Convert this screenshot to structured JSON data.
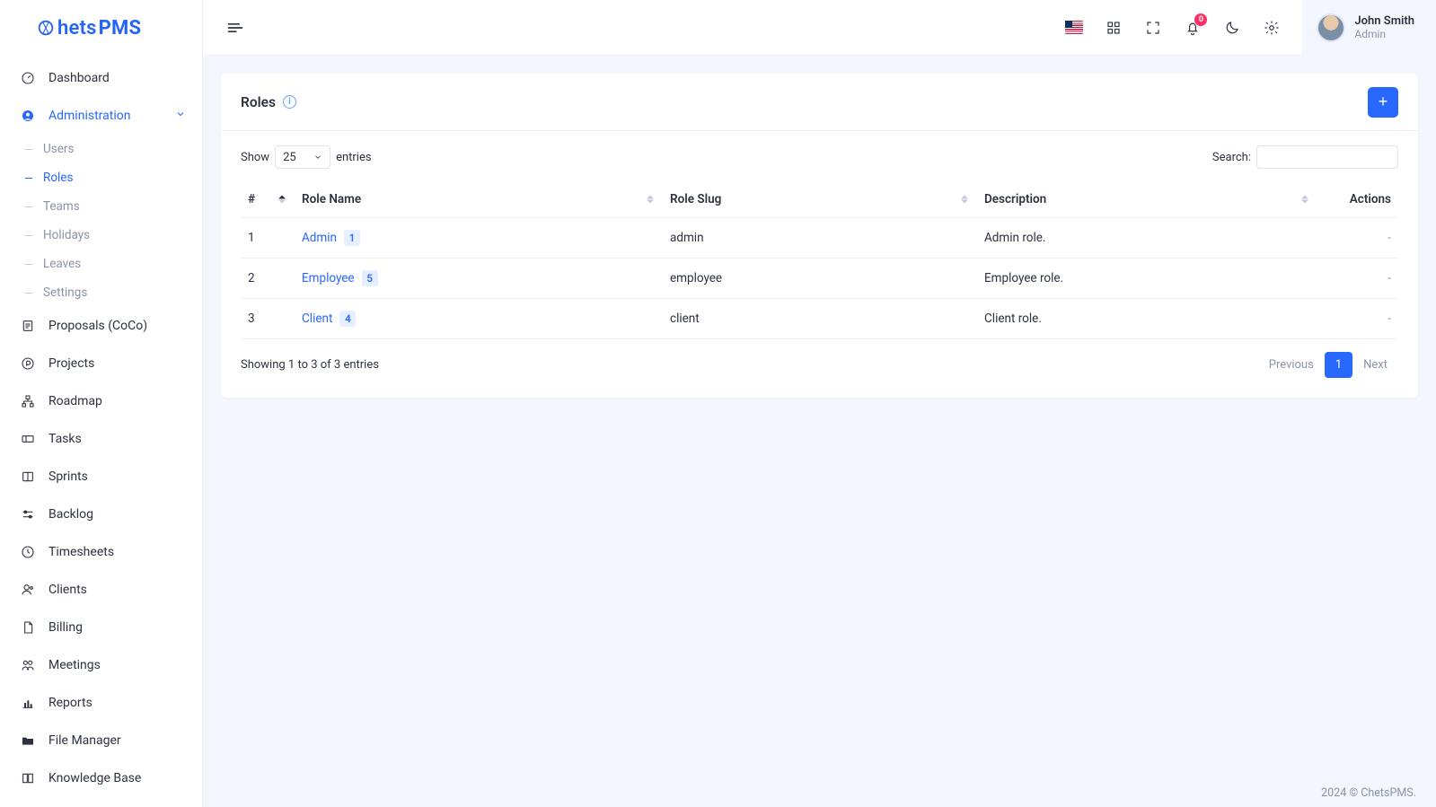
{
  "brand": {
    "name_a": "hets",
    "name_b": "PMS"
  },
  "header": {
    "notif_count": "0",
    "user": {
      "name": "John Smith",
      "role": "Admin"
    }
  },
  "sidebar": {
    "items": [
      {
        "label": "Dashboard"
      },
      {
        "label": "Administration",
        "active": true,
        "expanded": true
      },
      {
        "label": "Proposals (CoCo)"
      },
      {
        "label": "Projects"
      },
      {
        "label": "Roadmap"
      },
      {
        "label": "Tasks"
      },
      {
        "label": "Sprints"
      },
      {
        "label": "Backlog"
      },
      {
        "label": "Timesheets"
      },
      {
        "label": "Clients"
      },
      {
        "label": "Billing"
      },
      {
        "label": "Meetings"
      },
      {
        "label": "Reports"
      },
      {
        "label": "File Manager"
      },
      {
        "label": "Knowledge Base"
      }
    ],
    "admin_sub": [
      {
        "label": "Users"
      },
      {
        "label": "Roles",
        "active": true
      },
      {
        "label": "Teams"
      },
      {
        "label": "Holidays"
      },
      {
        "label": "Leaves"
      },
      {
        "label": "Settings"
      }
    ]
  },
  "page": {
    "title": "Roles",
    "add_label": "+",
    "show_label": "Show",
    "entries_label": "entries",
    "show_value": "25",
    "search_label": "Search:",
    "columns": {
      "idx": "#",
      "name": "Role Name",
      "slug": "Role Slug",
      "desc": "Description",
      "actions": "Actions"
    },
    "rows": [
      {
        "idx": "1",
        "name": "Admin",
        "count": "1",
        "slug": "admin",
        "desc": "Admin role.",
        "actions": "-"
      },
      {
        "idx": "2",
        "name": "Employee",
        "count": "5",
        "slug": "employee",
        "desc": "Employee role.",
        "actions": "-"
      },
      {
        "idx": "3",
        "name": "Client",
        "count": "4",
        "slug": "client",
        "desc": "Client role.",
        "actions": "-"
      }
    ],
    "info": "Showing 1 to 3 of 3 entries",
    "pager": {
      "prev": "Previous",
      "page": "1",
      "next": "Next"
    }
  },
  "footer": "2024 © ChetsPMS."
}
